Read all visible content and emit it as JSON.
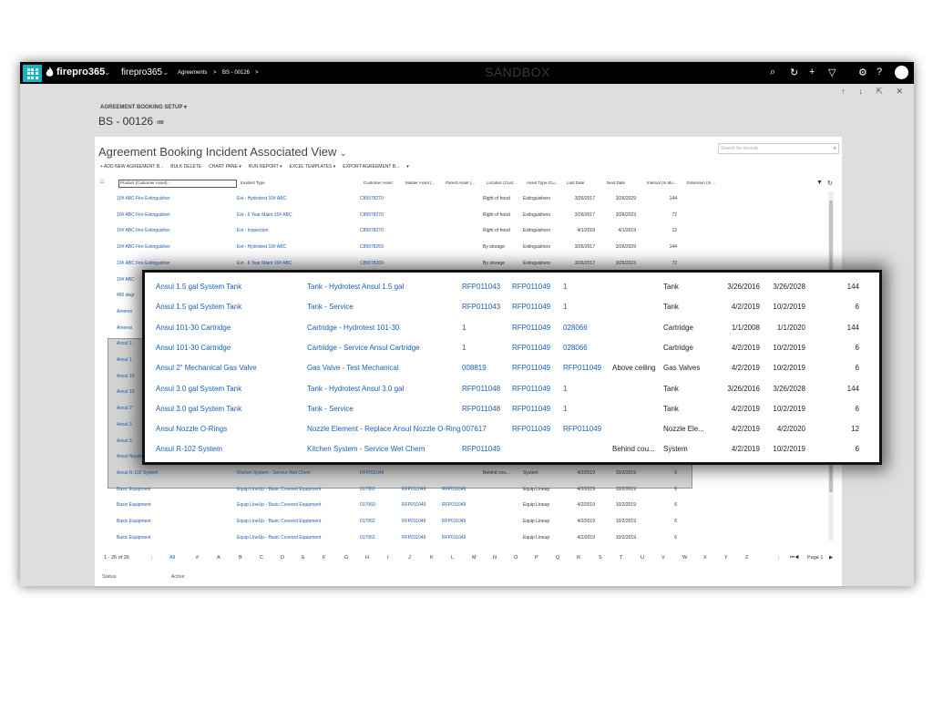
{
  "topbar": {
    "brand": "firepro365",
    "app_switch": "firepro365",
    "crumb_entity": "Agreements",
    "crumb_sep": ">",
    "crumb_record": "BS - 00126",
    "crumb_end": ">",
    "env": "SANDBOX",
    "icons": [
      "search-icon",
      "recent-icon",
      "add-icon",
      "filter-icon",
      "settings-icon",
      "help-icon",
      "user-avatar"
    ]
  },
  "nav": {
    "arrows": "↑ ↓ ⇱ ✕"
  },
  "record": {
    "form_label": "AGREEMENT BOOKING SETUP ▾",
    "name": "BS - 00126"
  },
  "view": {
    "title": "Agreement Booking Incident Associated View",
    "search_placeholder": "Search for records",
    "commands": [
      "+ ADD NEW AGREEMENT B...",
      "BULK DELETE",
      "CHART PANE ▾",
      "RUN REPORT ▾",
      "EXCEL TEMPLATES ▾",
      "EXPORT AGREEMENT B...",
      "▾"
    ],
    "columns": [
      "Product (Customer Asset) ↑",
      "Incident Type",
      "Customer Asset",
      "Master Asset (...",
      "Parent Asset (...",
      "Location (Cust...",
      "Asset Type (Cu...",
      "Last Date",
      "Next Date",
      "Interval (In Mo...",
      "Extension (In ..."
    ],
    "rows": [
      [
        "10# ABC Fire Extinguisher",
        "Ext - Hydrotest 10# ABC",
        "C89978270",
        "",
        "",
        "Right of hood",
        "Extinguishers",
        "3/26/2017",
        "3/26/2029",
        "144"
      ],
      [
        "10# ABC Fire Extinguisher",
        "Ext - 6 Year Maint 10# ABC",
        "C89978270",
        "",
        "",
        "Right of hood",
        "Extinguishers",
        "3/26/2017",
        "3/26/2023",
        "72"
      ],
      [
        "10# ABC Fire Extinguisher",
        "Ext - Inspection",
        "C89978270",
        "",
        "",
        "Right of hood",
        "Extinguishers",
        "4/1/2018",
        "4/1/2019",
        "12"
      ],
      [
        "10# ABC Fire Extinguisher",
        "Ext - Hydrotest 10# ABC",
        "C89978269",
        "",
        "",
        "By storage",
        "Extinguishers",
        "3/26/2017",
        "3/26/2029",
        "144"
      ],
      [
        "10# ABC Fire Extinguisher",
        "Ext - 6 Year Maint 10# ABC",
        "C89978269",
        "",
        "",
        "By storage",
        "Extinguishers",
        "3/26/2017",
        "3/26/2023",
        "72"
      ],
      [
        "10# ABC",
        "",
        "",
        "",
        "",
        "",
        "",
        "",
        "",
        ""
      ],
      [
        "450 degr",
        "",
        "",
        "",
        "",
        "",
        "",
        "",
        "",
        ""
      ],
      [
        "Ameres",
        "",
        "",
        "",
        "",
        "",
        "",
        "",
        "",
        ""
      ],
      [
        "Ameres",
        "",
        "",
        "",
        "",
        "",
        "",
        "",
        "",
        ""
      ],
      [
        "Ansul 1.",
        "",
        "",
        "",
        "",
        "",
        "",
        "",
        "",
        ""
      ],
      [
        "Ansul 1.",
        "",
        "",
        "",
        "",
        "",
        "",
        "",
        "",
        ""
      ],
      [
        "Ansul 10",
        "",
        "",
        "",
        "",
        "",
        "",
        "",
        "",
        ""
      ],
      [
        "Ansul 10",
        "",
        "",
        "",
        "",
        "",
        "",
        "",
        "",
        ""
      ],
      [
        "Ansul 2\"",
        "",
        "",
        "",
        "",
        "",
        "",
        "",
        "",
        ""
      ],
      [
        "Ansul 3.",
        "",
        "",
        "",
        "",
        "",
        "",
        "",
        "",
        ""
      ],
      [
        "Ansul 3.",
        "",
        "",
        "",
        "",
        "",
        "",
        "",
        "",
        ""
      ],
      [
        "Ansul Nozzle O-Rings",
        "Nozzle Element - Replace Ansul Nozzle O-Ring",
        "007617",
        "RFP011049",
        "RFP011049",
        "",
        "Nozzle Ele...",
        "4/2/2019",
        "4/2/2020",
        "12"
      ],
      [
        "Ansul R-102 System",
        "Kitchen System - Service Wet Chem",
        "RFP011049",
        "",
        "",
        "Behind cou...",
        "System",
        "4/2/2019",
        "10/2/2019",
        "6"
      ],
      [
        "Basic Equipment",
        "Equip LineUp - Basic Covered Equipment",
        "017061",
        "RFP011049",
        "RFP011049",
        "",
        "Equip Lineup",
        "4/2/2019",
        "10/2/2019",
        "6"
      ],
      [
        "Basic Equipment",
        "Equip LineUp - Basic Covered Equipment",
        "017060",
        "RFP011049",
        "RFP011049",
        "",
        "Equip Lineup",
        "4/2/2019",
        "10/2/2019",
        "6"
      ],
      [
        "Basic Equipment",
        "Equip LineUp - Basic Covered Equipment",
        "017062",
        "RFP011049",
        "RFP011049",
        "",
        "Equip Lineup",
        "4/2/2019",
        "10/2/2019",
        "6"
      ],
      [
        "Basic Equipment",
        "Equip LineUp - Basic Covered Equipment",
        "017062",
        "RFP011049",
        "RFP011049",
        "",
        "Equip Lineup",
        "4/2/2019",
        "10/2/2019",
        "6"
      ]
    ],
    "pager": {
      "count": "1 - 26 of 26",
      "letters": [
        "All",
        "#",
        "A",
        "B",
        "C",
        "D",
        "E",
        "F",
        "G",
        "H",
        "I",
        "J",
        "K",
        "L",
        "M",
        "N",
        "O",
        "P",
        "Q",
        "R",
        "S",
        "T",
        "U",
        "V",
        "W",
        "X",
        "Y",
        "Z"
      ],
      "page": "Page 1"
    },
    "status_label": "Status",
    "status_value": "Active"
  },
  "popup": {
    "rows": [
      [
        "Ansul 1.5 gal System Tank",
        "Tank - Hydrotest Ansul 1.5 gal",
        "RFP011043",
        "RFP011049",
        "1",
        "",
        "Tank",
        "3/26/2016",
        "3/26/2028",
        "144"
      ],
      [
        "Ansul 1.5 gal System Tank",
        "Tank - Service",
        "RFP011043",
        "RFP011049",
        "1",
        "",
        "Tank",
        "4/2/2019",
        "10/2/2019",
        "6"
      ],
      [
        "Ansul 101-30 Cartridge",
        "Cartridge - Hydrotest 101-30",
        "1",
        "RFP011049",
        "028066",
        "",
        "Cartridge",
        "1/1/2008",
        "1/1/2020",
        "144"
      ],
      [
        "Ansul 101-30 Cartridge",
        "Cartridge - Service Ansul Cartridge",
        "1",
        "RFP011049",
        "028066",
        "",
        "Cartridge",
        "4/2/2019",
        "10/2/2019",
        "6"
      ],
      [
        "Ansul 2\" Mechanical Gas Valve",
        "Gas Valve - Test Mechanical",
        "008819",
        "RFP011049",
        "RFP011049",
        "Above ceiling",
        "Gas Valves",
        "4/2/2019",
        "10/2/2019",
        "6"
      ],
      [
        "Ansul 3.0 gal System Tank",
        "Tank - Hydrotest Ansul 3.0 gal",
        "RFP011048",
        "RFP011049",
        "1",
        "",
        "Tank",
        "3/26/2016",
        "3/26/2028",
        "144"
      ],
      [
        "Ansul 3.0 gal System Tank",
        "Tank - Service",
        "RFP011048",
        "RFP011049",
        "1",
        "",
        "Tank",
        "4/2/2019",
        "10/2/2019",
        "6"
      ],
      [
        "Ansul Nozzle O-Rings",
        "Nozzle Element - Replace Ansul Nozzle O-Ring",
        "007617",
        "RFP011049",
        "RFP011049",
        "",
        "Nozzle Ele...",
        "4/2/2019",
        "4/2/2020",
        "12"
      ],
      [
        "Ansul R-102 System",
        "Kitchen System - Service Wet Chem",
        "RFP011049",
        "",
        "",
        "Behind cou...",
        "System",
        "4/2/2019",
        "10/2/2019",
        "6"
      ]
    ]
  }
}
